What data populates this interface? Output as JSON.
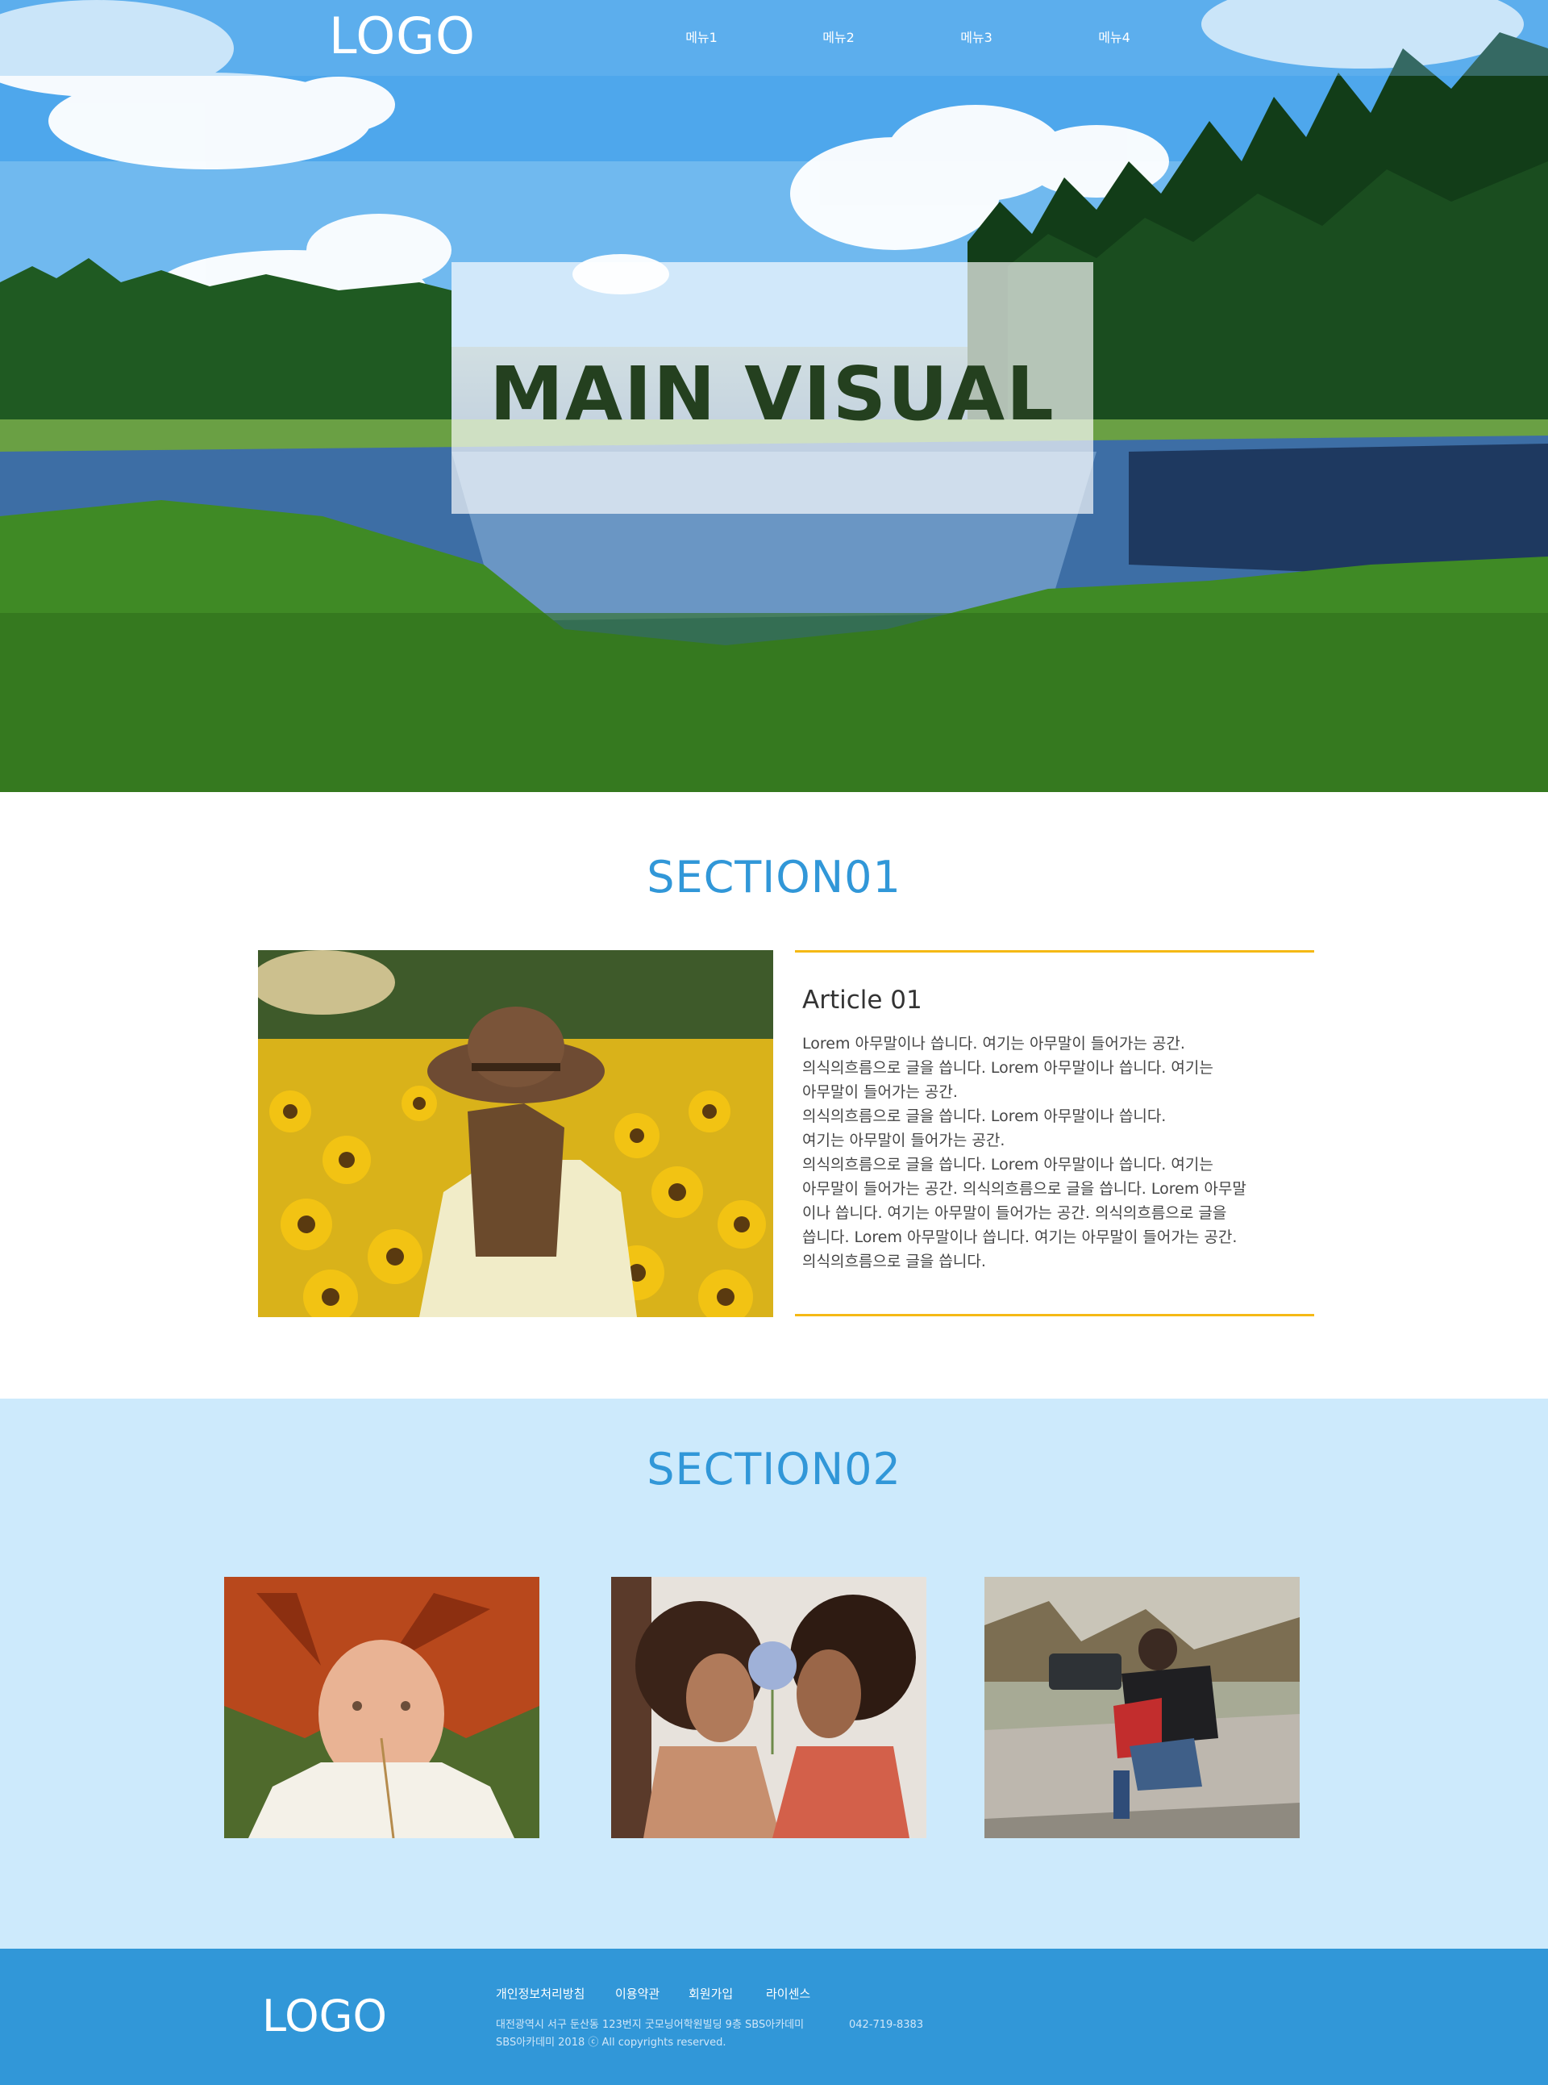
{
  "header": {
    "logo": "LOGO",
    "menu": [
      "메뉴1",
      "메뉴2",
      "메뉴3",
      "메뉴4"
    ]
  },
  "hero": {
    "title": "MAIN VISUAL"
  },
  "section01": {
    "title": "SECTION01",
    "article_title": "Article 01",
    "article_lines": [
      "Lorem 아무말이나 씁니다. 여기는 아무말이 들어가는 공간.",
      "의식의흐름으로 글을 씁니다. Lorem 아무말이나 씁니다. 여기는",
      "아무말이 들어가는 공간.",
      "의식의흐름으로 글을 씁니다. Lorem 아무말이나 씁니다.",
      "여기는 아무말이 들어가는 공간.",
      "의식의흐름으로 글을 씁니다. Lorem 아무말이나 씁니다. 여기는",
      "아무말이 들어가는 공간. 의식의흐름으로 글을 씁니다. Lorem 아무말",
      "이나 씁니다. 여기는 아무말이 들어가는 공간. 의식의흐름으로 글을",
      "씁니다. Lorem 아무말이나 씁니다. 여기는 아무말이 들어가는 공간.",
      "의식의흐름으로 글을 씁니다."
    ]
  },
  "section02": {
    "title": "SECTION02"
  },
  "footer": {
    "logo": "LOGO",
    "links": [
      "개인정보처리방침",
      "이용약관",
      "회원가입",
      "라이센스"
    ],
    "address": "대전광역시 서구 둔산동 123번지 굿모닝어학원빌딩 9층 SBS아카데미",
    "phone": "042-719-8383",
    "copyright": "SBS아카데미 2018 ⓒ All copyrights reserved."
  },
  "colors": {
    "accent": "#3197d8",
    "section02_bg": "#cdeafc",
    "article_rule": "#f5b915"
  }
}
